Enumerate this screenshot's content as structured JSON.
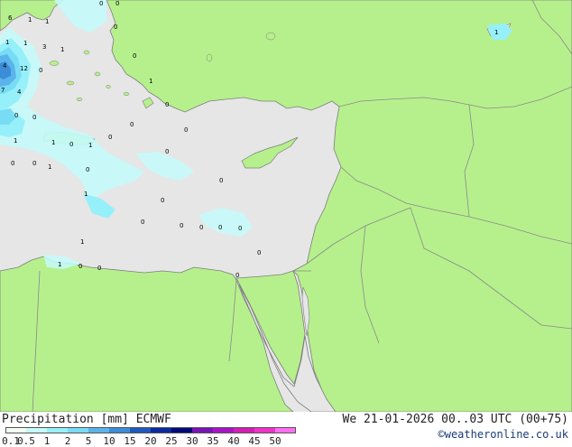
{
  "map": {
    "colors": {
      "land": "#b6f08c",
      "sea": "#e6e6e6",
      "borders": "#8a8a8a",
      "coast": "#7d7d7d"
    },
    "point_values": [
      "6",
      "1",
      "1",
      "1",
      "1",
      "3",
      "1",
      "4",
      "12",
      "7",
      "4",
      "0",
      "1",
      "0",
      "1",
      "0",
      "0",
      "1",
      "1",
      "0",
      "1",
      "0",
      "1",
      "1",
      "0",
      "0",
      "0",
      "0",
      "0",
      "0",
      "1",
      "0",
      "1",
      "0",
      "0",
      "0",
      "0",
      "0",
      "0",
      "0",
      "0",
      "0",
      "0",
      "0",
      "0",
      "0",
      "0"
    ]
  },
  "footer": {
    "title": "Precipitation [mm] ECMWF",
    "datetime": "We 21-01-2026 00..03 UTC (00+75)",
    "credit": "©weatheronline.co.uk"
  },
  "legend": {
    "labels": [
      "0.1",
      "0.5",
      "1",
      "2",
      "5",
      "10",
      "15",
      "20",
      "25",
      "30",
      "35",
      "40",
      "45",
      "50"
    ],
    "colors": [
      "#f2fff2",
      "#c4fafa",
      "#96f0fa",
      "#78dcf5",
      "#5ab4eb",
      "#3c8cd7",
      "#1e5abe",
      "#0a2a9e",
      "#000a78",
      "#7814b4",
      "#aa14c8",
      "#d21eb4",
      "#f032c8",
      "#ff6ef0"
    ]
  }
}
